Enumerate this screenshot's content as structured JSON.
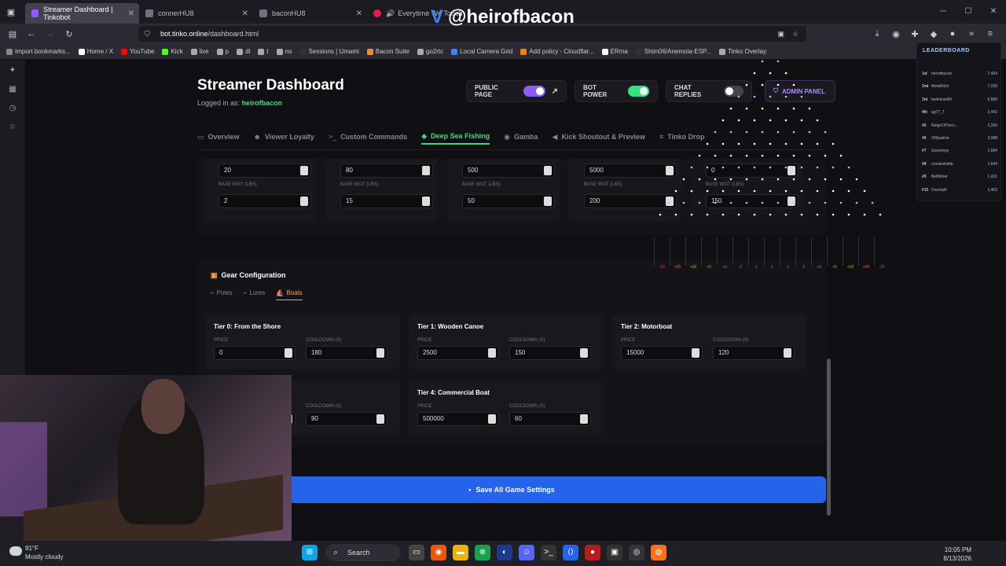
{
  "browser": {
    "tabs": [
      {
        "title": "Streamer Dashboard | Tinkobot",
        "active": true,
        "color": "#8b5cf6"
      },
      {
        "title": "connerHU8",
        "active": false,
        "color": "#6b7280"
      },
      {
        "title": "baconHU8",
        "active": false,
        "color": "#6b7280"
      },
      {
        "title": "Everytime We Touch",
        "active": false,
        "color": "#e11d48"
      }
    ],
    "url_host": "bot.tinko.online",
    "url_path": "/dashboard.html",
    "bookmarks": [
      {
        "label": "Import bookmarks...",
        "color": "#888"
      },
      {
        "label": "Home / X",
        "color": "#fff"
      },
      {
        "label": "YouTube",
        "color": "#ff0000"
      },
      {
        "label": "Kick",
        "color": "#53fc18"
      },
      {
        "label": "live",
        "color": "#aaa"
      },
      {
        "label": "p",
        "color": "#aaa"
      },
      {
        "label": "dl",
        "color": "#aaa"
      },
      {
        "label": "t",
        "color": "#aaa"
      },
      {
        "label": "no",
        "color": "#aaa"
      },
      {
        "label": "Sessions | Umami",
        "color": "#333"
      },
      {
        "label": "Bacon Suite",
        "color": "#e98c3f"
      },
      {
        "label": "go2rtc",
        "color": "#aaa"
      },
      {
        "label": "Local Camera Grid",
        "color": "#3b82f6"
      },
      {
        "label": "Add policy - Cloudflar...",
        "color": "#f38020"
      },
      {
        "label": "ERma",
        "color": "#fff"
      },
      {
        "label": "Shim06/Anemoia-ESP...",
        "color": "#333"
      },
      {
        "label": "Tinko Overlay",
        "color": "#aaa"
      }
    ]
  },
  "header": {
    "title": "Streamer Dashboard",
    "logged_prefix": "Logged in as:",
    "username": "heirofbacon",
    "public_page": "PUBLIC PAGE",
    "bot_power": "BOT POWER",
    "chat_replies": "CHAT REPLIES",
    "admin_panel": "ADMIN PANEL"
  },
  "nav": [
    {
      "label": "Overview",
      "icon": "▭",
      "active": false
    },
    {
      "label": "Viewer Loyalty",
      "icon": "☻",
      "active": false
    },
    {
      "label": "Custom Commands",
      "icon": ">_",
      "active": false
    },
    {
      "label": "Deep Sea Fishing",
      "icon": "◆",
      "active": true
    },
    {
      "label": "Gamba",
      "icon": "◉",
      "active": false
    },
    {
      "label": "Kick Shoutout & Preview",
      "icon": "◀",
      "active": false
    },
    {
      "label": "Tinko Drop",
      "icon": "≡",
      "active": false
    }
  ],
  "fish": {
    "base_wgt_label": "BASE WGT (LBS)",
    "cards": [
      {
        "top": "20",
        "base": "2"
      },
      {
        "top": "80",
        "base": "15"
      },
      {
        "top": "500",
        "base": "50"
      },
      {
        "top": "5000",
        "base": "200"
      },
      {
        "top": "0",
        "base": "150"
      }
    ]
  },
  "gear": {
    "title": "Gear Configuration",
    "tabs": [
      {
        "label": "Poles",
        "active": false
      },
      {
        "label": "Lures",
        "active": false
      },
      {
        "label": "Boats",
        "active": true
      }
    ],
    "price_label": "PRICE",
    "cooldown_label": "COOLDOWN (S)",
    "tiers": [
      {
        "title": "Tier 0: From the Shore",
        "price": "0",
        "cooldown": "180"
      },
      {
        "title": "Tier 1: Wooden Canoe",
        "price": "2500",
        "cooldown": "150"
      },
      {
        "title": "Tier 2: Motorboat",
        "price": "15000",
        "cooldown": "120"
      },
      {
        "title": "",
        "price": "",
        "cooldown": "90"
      },
      {
        "title": "Tier 4: Commercial Boat",
        "price": "500000",
        "cooldown": "60"
      }
    ]
  },
  "save_label": "Save All Game Settings",
  "overlay": {
    "handle": "@heirofbacon",
    "leaderboard_title": "LEADERBOARD",
    "leaderboard": [
      {
        "rank": "1st",
        "name": "heirofbacon",
        "pts": "7,494"
      },
      {
        "rank": "2nd",
        "name": "MetalRich",
        "pts": "7,036"
      },
      {
        "rank": "3rd",
        "name": "bellminer84",
        "pts": "6,689"
      },
      {
        "rank": "4th",
        "name": "ag77_7",
        "pts": "2,442"
      },
      {
        "rank": "#5",
        "name": "ReignOfTerro...",
        "pts": "2,336"
      },
      {
        "rank": "#6",
        "name": "209patriot",
        "pts": "2,088"
      },
      {
        "rank": "#7",
        "name": "Sooonnyy",
        "pts": "1,684"
      },
      {
        "rank": "#8",
        "name": "crookwhistle",
        "pts": "1,644"
      },
      {
        "rank": "#9",
        "name": "BellMiner",
        "pts": "1,431"
      },
      {
        "rank": "#10",
        "name": "Doompill",
        "pts": "1,403"
      }
    ],
    "plinko_slots": [
      "-20",
      "+20",
      "+10",
      "+5",
      "+3",
      "-2",
      "-1",
      "0",
      "-1",
      "-2",
      "+3",
      "+5",
      "+10",
      "+20",
      "-20"
    ]
  },
  "taskbar": {
    "temp": "91°F",
    "weather": "Mostly cloudy",
    "search": "Search",
    "time": "10:05 PM",
    "date": "8/13/2026"
  },
  "colors": {
    "accent_green": "#2ee37a",
    "accent_purple": "#8b5cf6",
    "accent_blue": "#2563eb",
    "accent_orange": "#f5a04a"
  }
}
